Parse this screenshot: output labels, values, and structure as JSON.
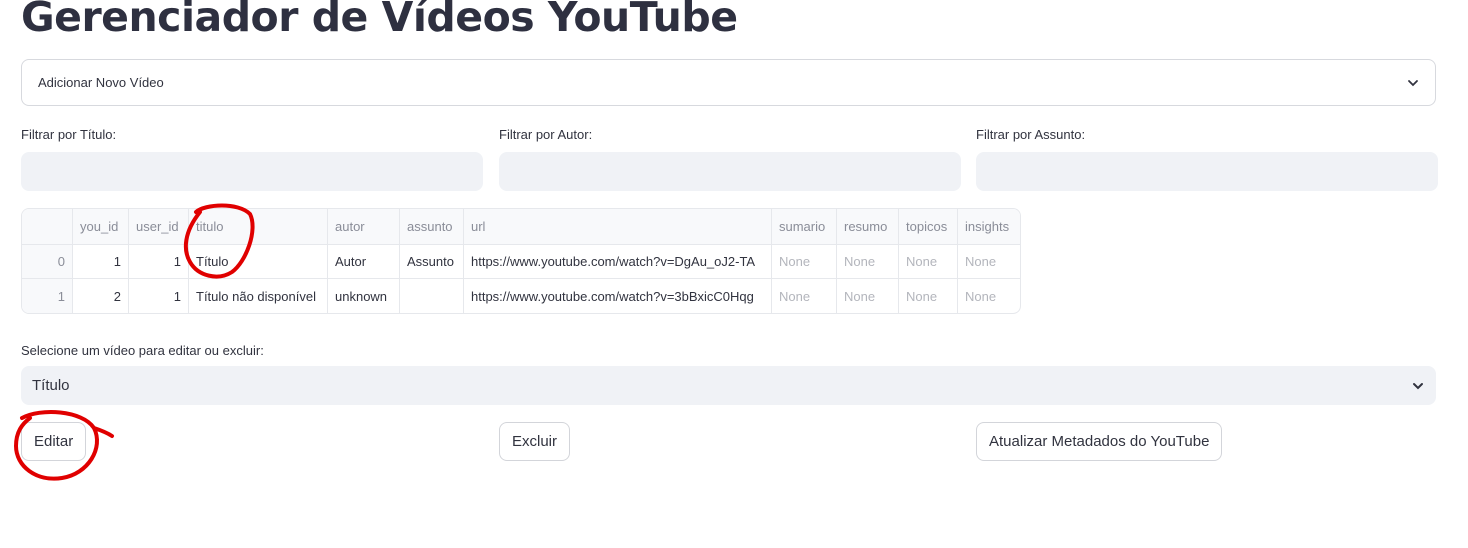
{
  "page": {
    "title": "Gerenciador de Vídeos YouTube"
  },
  "expander": {
    "label": "Adicionar Novo Vídeo"
  },
  "filters": {
    "title_label": "Filtrar por Título:",
    "author_label": "Filtrar por Autor:",
    "subject_label": "Filtrar por Assunto:"
  },
  "table": {
    "headers": [
      "",
      "you_id",
      "user_id",
      "titulo",
      "autor",
      "assunto",
      "url",
      "sumario",
      "resumo",
      "topicos",
      "insights"
    ],
    "rows": [
      [
        "0",
        "1",
        "1",
        "Título",
        "Autor",
        "Assunto",
        "https://www.youtube.com/watch?v=DgAu_oJ2-TA",
        "None",
        "None",
        "None",
        "None"
      ],
      [
        "1",
        "2",
        "1",
        "Título não disponível",
        "unknown",
        "",
        "https://www.youtube.com/watch?v=3bBxicC0Hqg",
        "None",
        "None",
        "None",
        "None"
      ]
    ]
  },
  "select": {
    "label": "Selecione um vídeo para editar ou excluir:",
    "value": "Título"
  },
  "buttons": {
    "edit": "Editar",
    "delete": "Excluir",
    "update": "Atualizar Metadados do YouTube"
  },
  "icons": {
    "expander": "chevron-down-icon",
    "select": "chevron-down-icon"
  },
  "colors": {
    "annotation": "#e00000",
    "input_bg": "#f0f2f6",
    "text": "#31333f"
  }
}
